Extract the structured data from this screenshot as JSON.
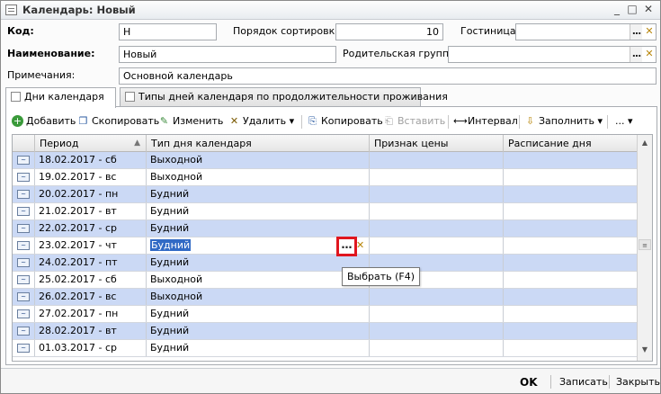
{
  "window": {
    "title": "Календарь: Новый"
  },
  "form": {
    "code_label": "Код:",
    "code_value": "Н",
    "sort_label": "Порядок сортировки:",
    "sort_value": "10",
    "hotel_label": "Гостиница:",
    "hotel_value": "",
    "name_label": "Наименование:",
    "name_value": "Новый",
    "parent_label": "Родительская группа:",
    "parent_value": "",
    "notes_label": "Примечания:",
    "notes_value": "Основной календарь"
  },
  "tabs": [
    {
      "label": "Дни календаря"
    },
    {
      "label": "Типы дней календаря по продолжительности проживания"
    }
  ],
  "toolbar": {
    "add": "Добавить",
    "copy": "Скопировать",
    "edit": "Изменить",
    "delete": "Удалить",
    "copy2": "Копировать",
    "paste": "Вставить",
    "interval": "Интервал",
    "fill": "Заполнить",
    "more": "..."
  },
  "grid": {
    "columns": [
      "Период",
      "Тип дня календаря",
      "Признак цены",
      "Расписание дня"
    ],
    "rows": [
      {
        "period": "18.02.2017 - сб",
        "type": "Выходной"
      },
      {
        "period": "19.02.2017 - вс",
        "type": "Выходной"
      },
      {
        "period": "20.02.2017 - пн",
        "type": "Будний"
      },
      {
        "period": "21.02.2017 - вт",
        "type": "Будний"
      },
      {
        "period": "22.02.2017 - ср",
        "type": "Будний"
      },
      {
        "period": "23.02.2017 - чт",
        "type": "Будний"
      },
      {
        "period": "24.02.2017 - пт",
        "type": "Будний"
      },
      {
        "period": "25.02.2017 - сб",
        "type": "Выходной"
      },
      {
        "period": "26.02.2017 - вс",
        "type": "Выходной"
      },
      {
        "period": "27.02.2017 - пн",
        "type": "Будний"
      },
      {
        "period": "28.02.2017 - вт",
        "type": "Будний"
      },
      {
        "period": "01.03.2017 - ср",
        "type": "Будний"
      }
    ],
    "selected_row": 5
  },
  "tooltip": "Выбрать (F4)",
  "footer": {
    "ok": "OK",
    "save": "Записать",
    "close": "Закрыть"
  },
  "colors": {
    "row_alt": "#cbd9f5",
    "selection": "#316ac5",
    "highlight_frame": "#e0161f"
  }
}
